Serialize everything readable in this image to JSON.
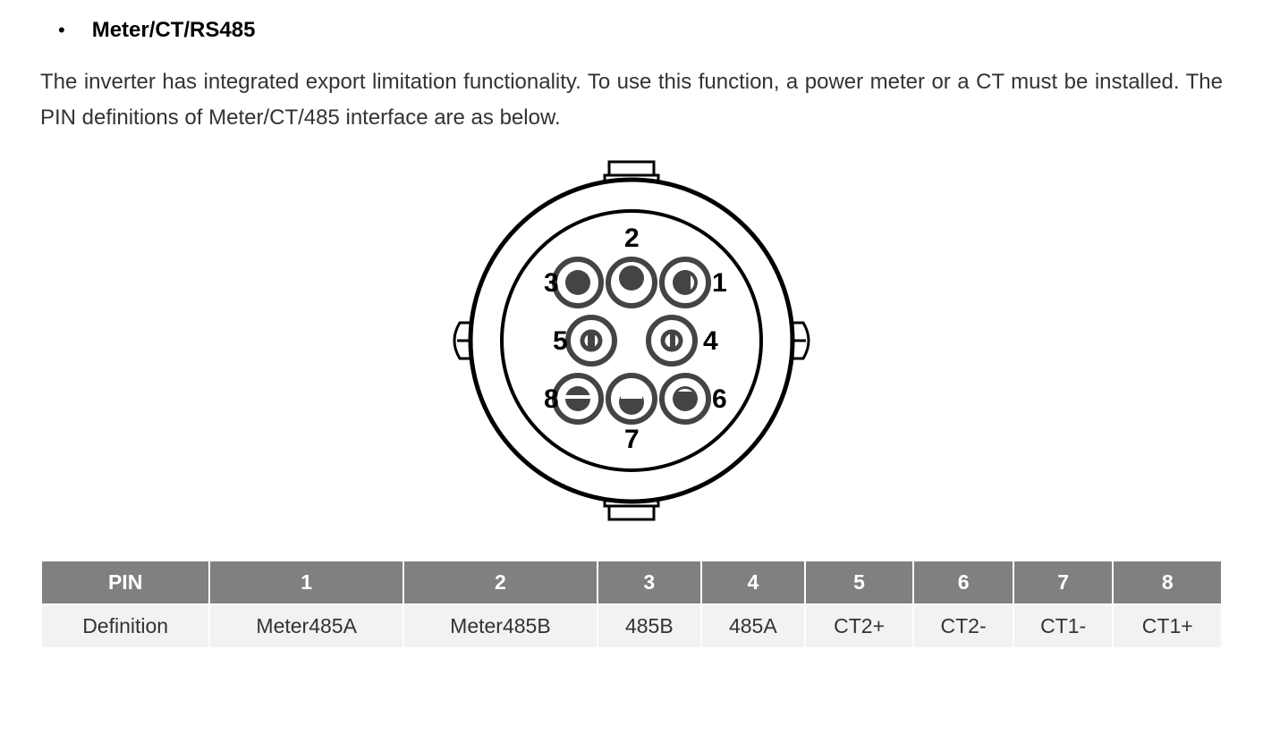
{
  "heading": "Meter/CT/RS485",
  "body": "The inverter has integrated export limitation functionality. To use this function, a power meter or a CT must be installed. The PIN definitions of Meter/CT/485 interface are as below.",
  "diagram": {
    "pin_labels": [
      "1",
      "2",
      "3",
      "4",
      "5",
      "6",
      "7",
      "8"
    ]
  },
  "table": {
    "header": [
      "PIN",
      "1",
      "2",
      "3",
      "4",
      "5",
      "6",
      "7",
      "8"
    ],
    "row": [
      "Definition",
      "Meter485A",
      "Meter485B",
      "485B",
      "485A",
      "CT2+",
      "CT2-",
      "CT1-",
      "CT1+"
    ]
  }
}
